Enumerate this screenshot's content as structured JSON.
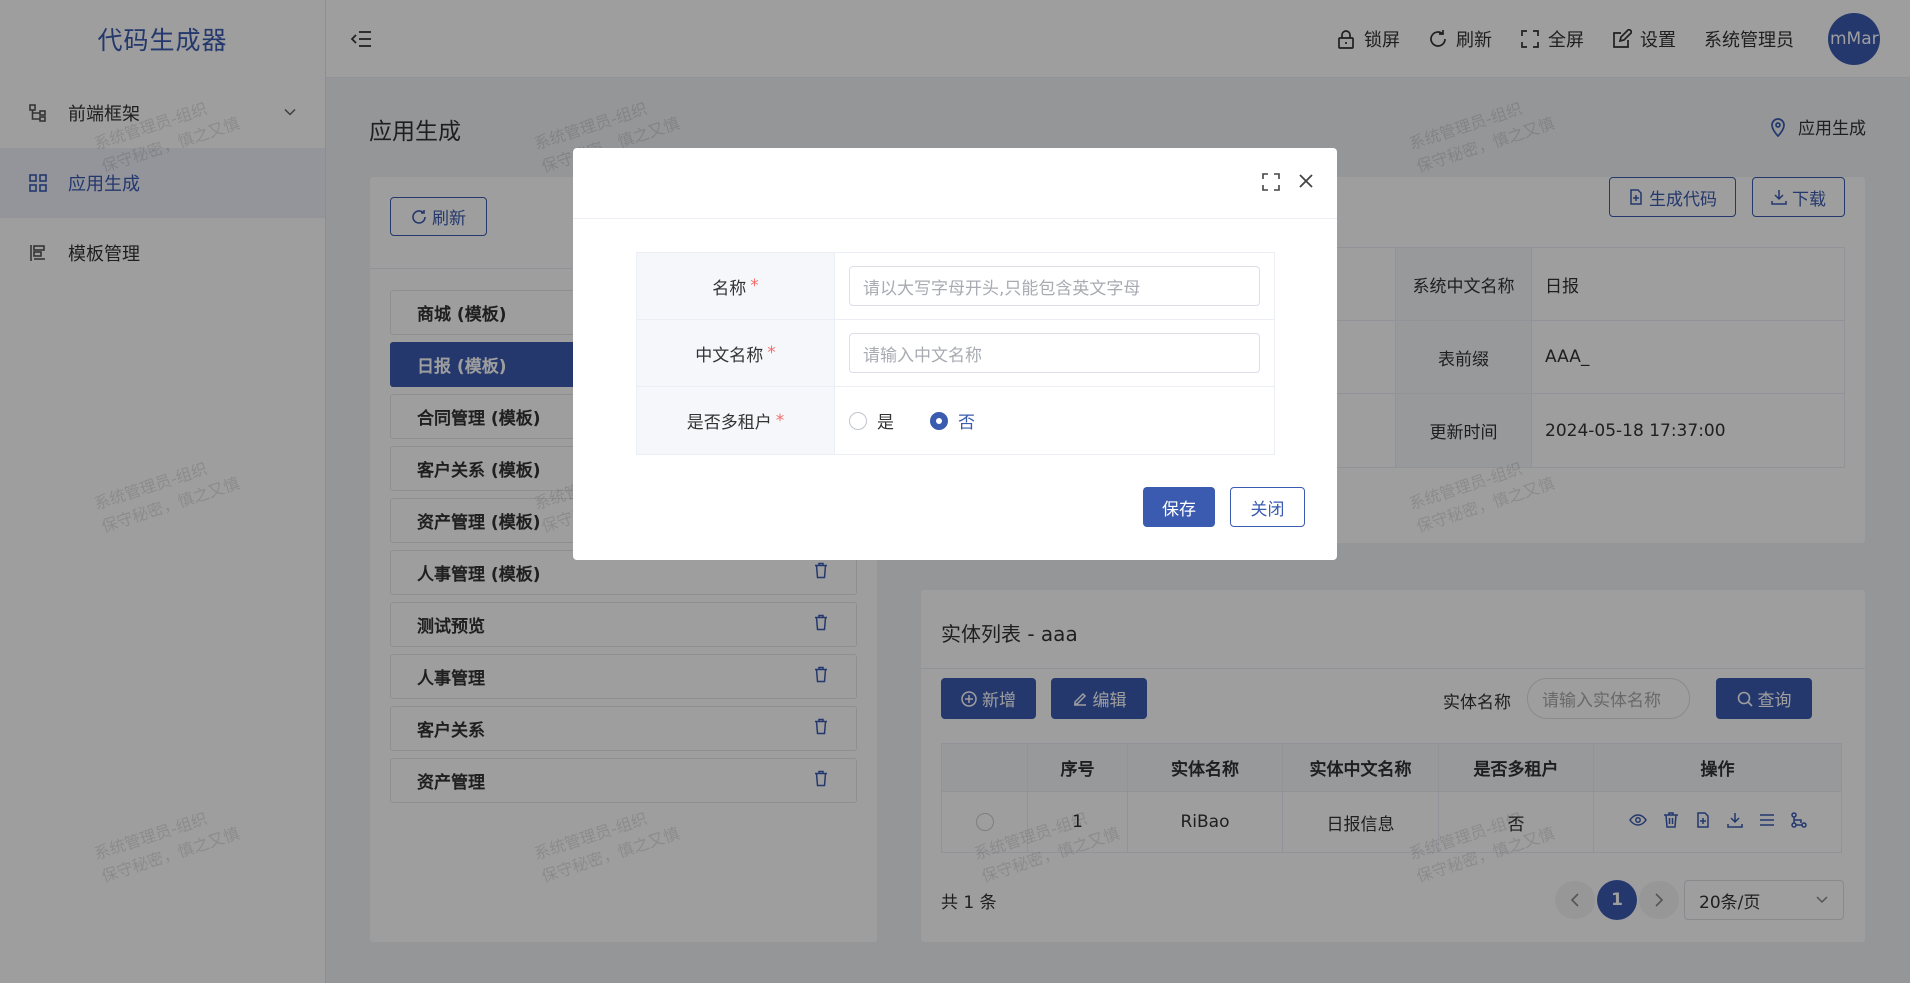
{
  "sidebar": {
    "logo": "代码生成器",
    "items": [
      {
        "label": "前端框架"
      },
      {
        "label": "应用生成"
      },
      {
        "label": "模板管理"
      }
    ]
  },
  "header": {
    "lock": "锁屏",
    "refresh": "刷新",
    "fullscreen": "全屏",
    "settings": "设置",
    "user": "系统管理员",
    "avatar": "mMar"
  },
  "page": {
    "title": "应用生成",
    "breadcrumb": "应用生成"
  },
  "left": {
    "refresh_label": "刷新",
    "apps": [
      {
        "label": "商城 (模板)"
      },
      {
        "label": "日报 (模板)"
      },
      {
        "label": "合同管理 (模板)"
      },
      {
        "label": "客户关系 (模板)"
      },
      {
        "label": "资产管理 (模板)"
      },
      {
        "label": "人事管理 (模板)"
      },
      {
        "label": "测试预览"
      },
      {
        "label": "人事管理"
      },
      {
        "label": "客户关系"
      },
      {
        "label": "资产管理"
      }
    ]
  },
  "detail": {
    "gen_code": "生成代码",
    "download": "下载",
    "rows": [
      {
        "label": "系统中文名称",
        "value": "日报"
      },
      {
        "label": "表前缀",
        "value": "AAA_"
      },
      {
        "label": "更新时间",
        "value": "2024-05-18 17:37:00"
      }
    ]
  },
  "entity": {
    "title": "实体列表 - aaa",
    "add": "新增",
    "edit": "编辑",
    "search_label": "实体名称",
    "search_placeholder": "请输入实体名称",
    "query": "查询",
    "headers": [
      "",
      "序号",
      "实体名称",
      "实体中文名称",
      "是否多租户",
      "操作"
    ],
    "rows": [
      {
        "index": "1",
        "name": "RiBao",
        "cn_name": "日报信息",
        "multi": "否"
      }
    ],
    "total": "共 1 条",
    "page": "1",
    "page_size": "20条/页"
  },
  "watermark": {
    "line1": "系统管理员-组织",
    "line2": "保守秘密，慎之又慎"
  },
  "modal": {
    "fields": [
      {
        "label": "名称",
        "placeholder": "请以大写字母开头,只能包含英文字母"
      },
      {
        "label": "中文名称",
        "placeholder": "请输入中文名称"
      },
      {
        "label": "是否多租户"
      }
    ],
    "required_mark": "*",
    "radio_yes": "是",
    "radio_no": "否",
    "save": "保存",
    "close": "关闭"
  },
  "colors": {
    "primary": "#3a5bb0",
    "required": "#f56c6c"
  }
}
